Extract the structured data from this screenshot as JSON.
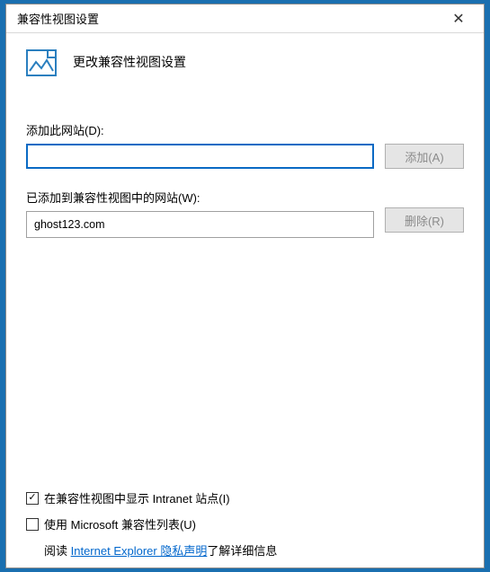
{
  "titlebar": {
    "title": "兼容性视图设置"
  },
  "header": {
    "title": "更改兼容性视图设置"
  },
  "add_section": {
    "label": "添加此网站(D):",
    "input_value": "",
    "button_label": "添加(A)"
  },
  "list_section": {
    "label": "已添加到兼容性视图中的网站(W):",
    "items": [
      "ghost123.com"
    ],
    "remove_button_label": "删除(R)"
  },
  "options": {
    "intranet_checkbox": {
      "checked": true,
      "label": "在兼容性视图中显示 Intranet 站点(I)"
    },
    "ms_list_checkbox": {
      "checked": false,
      "label": "使用 Microsoft 兼容性列表(U)"
    },
    "info_prefix": "阅读 ",
    "info_link": "Internet Explorer 隐私声明",
    "info_suffix": "了解详细信息"
  }
}
